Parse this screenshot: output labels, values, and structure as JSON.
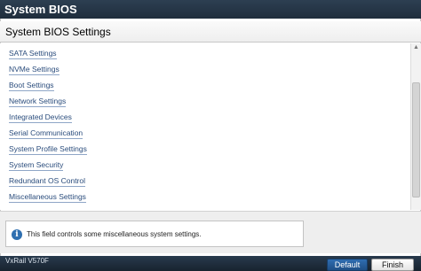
{
  "window": {
    "title": "System BIOS"
  },
  "section": {
    "title": "System BIOS Settings"
  },
  "menu": [
    {
      "label": "SATA Settings"
    },
    {
      "label": "NVMe Settings"
    },
    {
      "label": "Boot Settings"
    },
    {
      "label": "Network Settings"
    },
    {
      "label": "Integrated Devices"
    },
    {
      "label": "Serial Communication"
    },
    {
      "label": "System Profile Settings"
    },
    {
      "label": "System Security"
    },
    {
      "label": "Redundant OS Control"
    },
    {
      "label": "Miscellaneous Settings"
    }
  ],
  "help": {
    "icon": "info-icon",
    "text": "This field controls some miscellaneous system settings."
  },
  "footer": {
    "model": "VxRail V570F",
    "buttons": {
      "default_label": "Default",
      "finish_label": "Finish"
    }
  }
}
